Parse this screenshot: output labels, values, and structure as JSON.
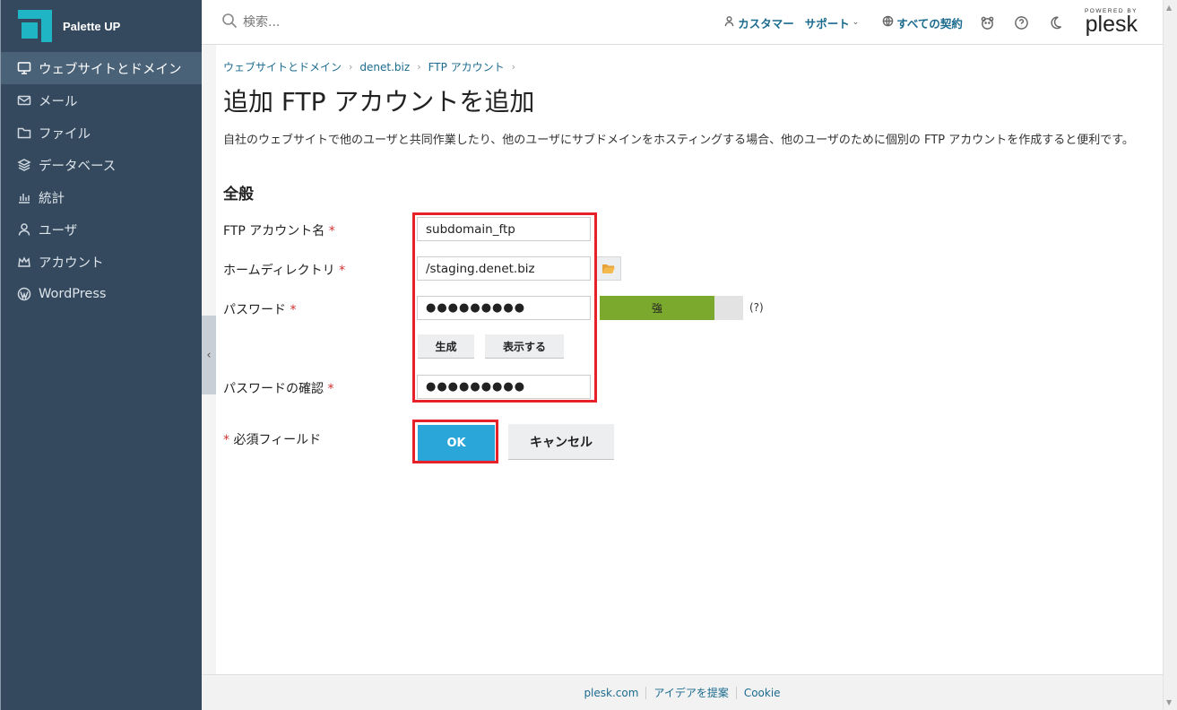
{
  "app": {
    "name": "Palette UP"
  },
  "sidebar": {
    "items": [
      {
        "label": "ウェブサイトとドメイン",
        "icon": "monitor-icon",
        "active": true
      },
      {
        "label": "メール",
        "icon": "mail-icon"
      },
      {
        "label": "ファイル",
        "icon": "folder-icon"
      },
      {
        "label": "データベース",
        "icon": "database-icon"
      },
      {
        "label": "統計",
        "icon": "stats-icon"
      },
      {
        "label": "ユーザ",
        "icon": "user-icon"
      },
      {
        "label": "アカウント",
        "icon": "crown-icon"
      },
      {
        "label": "WordPress",
        "icon": "wordpress-icon"
      }
    ],
    "collapse_glyph": "‹"
  },
  "topbar": {
    "search_placeholder": "検索...",
    "customer_label": "カスタマー",
    "support_label": "サポート",
    "subscriptions_label": "すべての契約",
    "powered_by": "POWERED BY",
    "plesk": "plesk"
  },
  "breadcrumb": [
    "ウェブサイトとドメイン",
    "denet.biz",
    "FTP アカウント"
  ],
  "page": {
    "title": "追加 FTP アカウントを追加",
    "description": "自社のウェブサイトで他のユーザと共同作業したり、他のユーザにサブドメインをホスティングする場合、他のユーザのために個別の FTP アカウントを作成すると便利です。",
    "section_title": "全般"
  },
  "form": {
    "ftp_account_label": "FTP アカウント名",
    "ftp_account_value": "subdomain_ftp",
    "home_dir_label": "ホームディレクトリ",
    "home_dir_value": "/staging.denet.biz",
    "password_label": "パスワード",
    "password_value": "●●●●●●●●●",
    "strength_label": "強",
    "strength_level": 0.8,
    "strength_help": "(?)",
    "generate_label": "生成",
    "show_label": "表示する",
    "confirm_label": "パスワードの確認",
    "confirm_value": "●●●●●●●●●",
    "required_mark": "*",
    "required_note": "必須フィールド",
    "ok_label": "OK",
    "cancel_label": "キャンセル"
  },
  "footer": {
    "links": [
      "plesk.com",
      "アイデアを提案",
      "Cookie"
    ]
  },
  "colors": {
    "sidebar_bg": "#34495e",
    "accent": "#2aa6d9",
    "link": "#1c6b8e",
    "strength": "#7ba92e",
    "highlight": "#e8202a",
    "required": "#d03030"
  }
}
